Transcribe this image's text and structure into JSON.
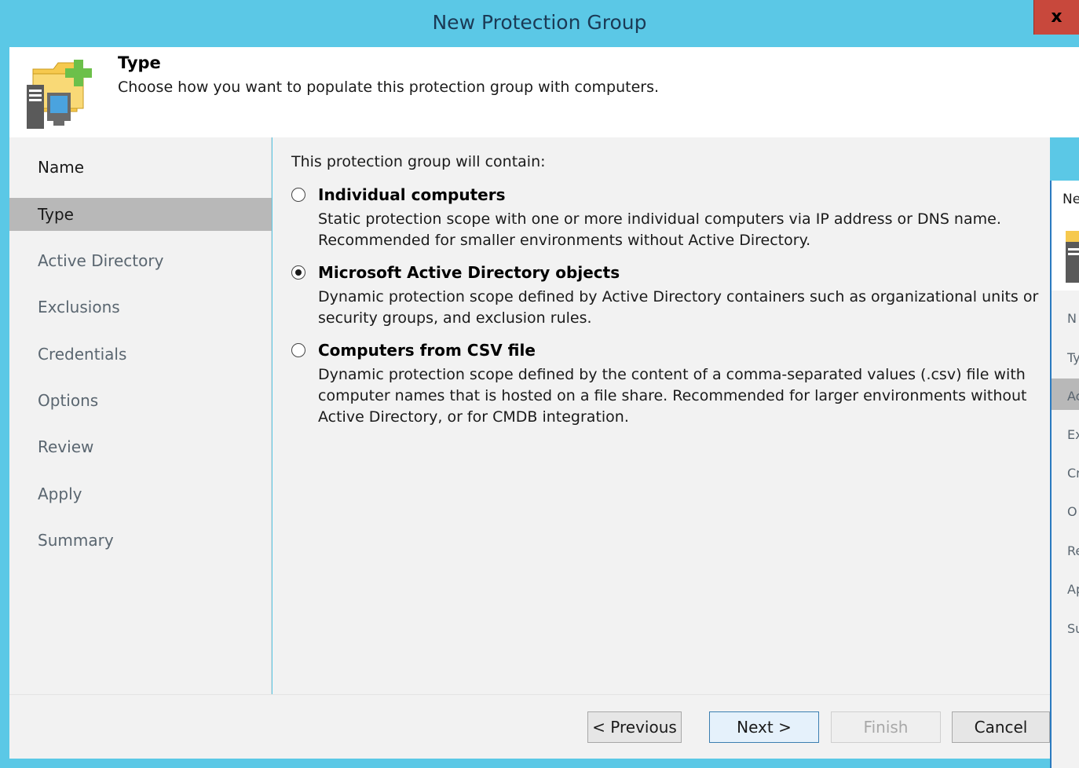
{
  "window": {
    "title": "New Protection Group",
    "close_label": "x"
  },
  "header": {
    "title": "Type",
    "description": "Choose how you want to populate this protection group with computers.",
    "icon": "protection-group-icon"
  },
  "sidebar": {
    "steps": [
      {
        "label": "Name",
        "state": "done"
      },
      {
        "label": "Type",
        "state": "active"
      },
      {
        "label": "Active Directory",
        "state": "pending"
      },
      {
        "label": "Exclusions",
        "state": "pending"
      },
      {
        "label": "Credentials",
        "state": "pending"
      },
      {
        "label": "Options",
        "state": "pending"
      },
      {
        "label": "Review",
        "state": "pending"
      },
      {
        "label": "Apply",
        "state": "pending"
      },
      {
        "label": "Summary",
        "state": "pending"
      }
    ]
  },
  "main": {
    "intro": "This protection group will contain:",
    "options": [
      {
        "title": "Individual computers",
        "description": "Static protection scope with one or more individual computers via IP address or DNS name. Recommended for smaller environments without Active Directory.",
        "selected": false
      },
      {
        "title": "Microsoft Active Directory objects",
        "description": "Dynamic protection scope defined by Active Directory containers such as organizational units or security groups, and exclusion rules.",
        "selected": true
      },
      {
        "title": "Computers from CSV file",
        "description": "Dynamic protection scope defined by the content of a comma-separated values (.csv) file with computer names that is hosted on a file share. Recommended for larger environments without Active Directory, or for CMDB integration.",
        "selected": false
      }
    ]
  },
  "footer": {
    "previous_label": "< Previous",
    "next_label": "Next >",
    "finish_label": "Finish",
    "cancel_label": "Cancel"
  },
  "background_window": {
    "title_fragment": "Ne",
    "items": [
      "N",
      "Ty",
      "Ac",
      "Ex",
      "Cr",
      "O",
      "Re",
      "Ap",
      "Su"
    ]
  },
  "colors": {
    "titlebar": "#5bc8e6",
    "close_button": "#c8483c",
    "panel": "#f2f2f2",
    "active_step": "#b8b8b8"
  }
}
